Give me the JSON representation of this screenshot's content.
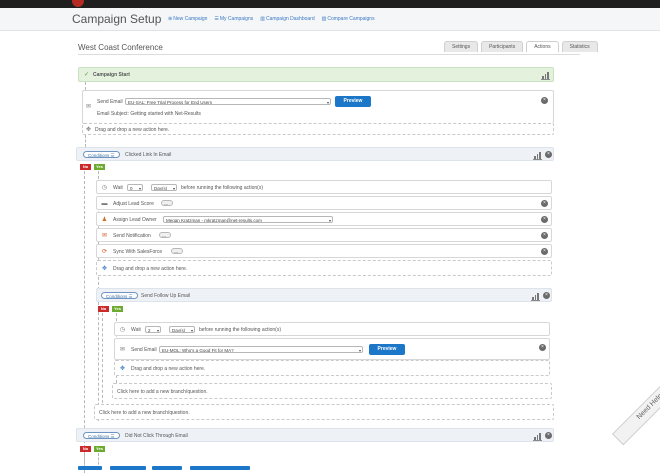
{
  "header": {
    "title": "Campaign Setup",
    "links": [
      {
        "label": "New Campaign",
        "icon": "plus-icon"
      },
      {
        "label": "My Campaigns",
        "icon": "list-icon"
      },
      {
        "label": "Campaign Dashboard",
        "icon": "chart-icon"
      },
      {
        "label": "Compare Campaigns",
        "icon": "chart-icon"
      }
    ]
  },
  "campaign": {
    "name": "West Coast Conference"
  },
  "tabs": [
    "Settings",
    "Participants",
    "Actions",
    "Statistics"
  ],
  "active_tab": "Actions",
  "flow": {
    "start_label": "Campaign Start",
    "send_email": {
      "label": "Send Email",
      "selected": "EU-SAL: Free Trial Process for End Users",
      "subject_label": "Email Subject: Getting started with Net-Results",
      "preview": "Preview"
    },
    "drag_drop": "Drag and drop a new action here.",
    "condition_badge": "Conditions",
    "condition1": "Clicked Link In Email",
    "yes": "Yes",
    "no": "No",
    "wait": {
      "label": "Wait",
      "value": "0",
      "unit": "Day(s)",
      "suffix": "before running the following action(s)"
    },
    "adjust_score": {
      "label": "Adjust Lead Score",
      "value": "---"
    },
    "assign_owner": {
      "label": "Assign Lead Owner",
      "value": "Megan Kratzman - mkratzman@net-results.com"
    },
    "send_notification": {
      "label": "Send Notification",
      "value": "---"
    },
    "sync_salesforce": {
      "label": "Sync With SalesForce",
      "value": "---"
    },
    "drag_drop2": "Drag and drop a new action here.",
    "condition2": "Send Follow Up Email",
    "wait2": {
      "label": "Wait",
      "value": "2",
      "unit": "Day(s)",
      "suffix": "before running the following action(s)"
    },
    "send_email2": {
      "label": "Send Email",
      "selected": "EU-MQL: Who's a Good Fit for MA?",
      "preview": "Preview"
    },
    "drag_drop3": "Drag and drop a new action here.",
    "add_branch_inner": "Click here to add a new branch/question.",
    "add_branch_outer": "Click here to add a new branch/question.",
    "condition3": "Did Not Click Through Email"
  },
  "help_tab": "Need Help",
  "colors": {
    "accent": "#1d77c9",
    "yes": "#6cab2f",
    "no": "#cc2a2a",
    "start_bg": "#e4f2dd"
  }
}
